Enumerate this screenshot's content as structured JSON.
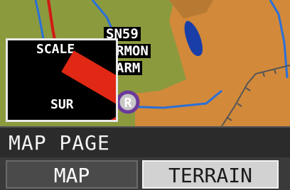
{
  "map": {
    "waypoint_lines": [
      "SN59",
      "RMON",
      "ARM"
    ],
    "airport_symbol": "R",
    "colors": {
      "terrain": "#d2893a",
      "green": "#8c9a3e",
      "water": "#1a3ea8",
      "road": "#2a70d8",
      "route": "#d21a14"
    }
  },
  "scale_box": {
    "label_top": "SCALE",
    "label_bottom": "SUR",
    "status": "unavailable"
  },
  "page_title": "MAP PAGE",
  "tabs": [
    {
      "label": "MAP",
      "selected": false
    },
    {
      "label": "TERRAIN",
      "selected": true
    }
  ]
}
